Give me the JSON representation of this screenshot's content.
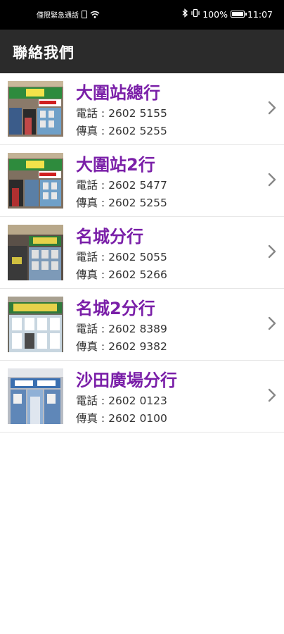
{
  "status_bar": {
    "left_text": "僅限緊急通話",
    "battery": "100%",
    "time": "11:07"
  },
  "header": {
    "title": "聯絡我們"
  },
  "branches": [
    {
      "name": "大圍站總行",
      "phone": "電話 : 2602 5155",
      "fax": "傳真 : 2602 5255",
      "photo_sign_color": "#2e8b3d"
    },
    {
      "name": "大圍站2行",
      "phone": "電話 : 2602 5477",
      "fax": "傳真 : 2602 5255",
      "photo_sign_color": "#2e8b3d"
    },
    {
      "name": "名城分行",
      "phone": "電話 : 2602 5055",
      "fax": "傳真 : 2602 5266",
      "photo_sign_color": "#2f7a3a"
    },
    {
      "name": "名城2分行",
      "phone": "電話 : 2602 8389",
      "fax": "傳真 : 2602 9382",
      "photo_sign_color": "#2f7a3a"
    },
    {
      "name": "沙田廣場分行",
      "phone": "電話 : 2602 0123",
      "fax": "傳真 : 2602 0100",
      "photo_sign_color": "#3a6fb0"
    }
  ],
  "colors": {
    "accent": "#7a1fa8",
    "app_bar": "#2b2b2b",
    "status_bar": "#000000"
  }
}
